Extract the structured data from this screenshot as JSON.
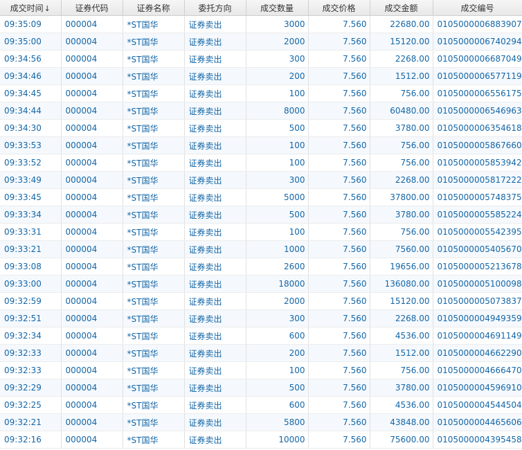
{
  "columns": [
    {
      "label": "成交时间",
      "sort_icon": "arrow-down-icon",
      "sort_glyph": "↓"
    },
    {
      "label": "证券代码"
    },
    {
      "label": "证券名称"
    },
    {
      "label": "委托方向"
    },
    {
      "label": "成交数量"
    },
    {
      "label": "成交价格"
    },
    {
      "label": "成交金额"
    },
    {
      "label": "成交编号"
    }
  ],
  "rows": [
    [
      "09:35:09",
      "000004",
      "*ST国华",
      "证券卖出",
      "3000",
      "7.560",
      "22680.00",
      "0105000006883907"
    ],
    [
      "09:35:00",
      "000004",
      "*ST国华",
      "证券卖出",
      "2000",
      "7.560",
      "15120.00",
      "0105000006740294"
    ],
    [
      "09:34:56",
      "000004",
      "*ST国华",
      "证券卖出",
      "300",
      "7.560",
      "2268.00",
      "0105000006687049"
    ],
    [
      "09:34:46",
      "000004",
      "*ST国华",
      "证券卖出",
      "200",
      "7.560",
      "1512.00",
      "0105000006577119"
    ],
    [
      "09:34:45",
      "000004",
      "*ST国华",
      "证券卖出",
      "100",
      "7.560",
      "756.00",
      "0105000006556175"
    ],
    [
      "09:34:44",
      "000004",
      "*ST国华",
      "证券卖出",
      "8000",
      "7.560",
      "60480.00",
      "0105000006546963"
    ],
    [
      "09:34:30",
      "000004",
      "*ST国华",
      "证券卖出",
      "500",
      "7.560",
      "3780.00",
      "0105000006354618"
    ],
    [
      "09:33:53",
      "000004",
      "*ST国华",
      "证券卖出",
      "100",
      "7.560",
      "756.00",
      "0105000005867660"
    ],
    [
      "09:33:52",
      "000004",
      "*ST国华",
      "证券卖出",
      "100",
      "7.560",
      "756.00",
      "0105000005853942"
    ],
    [
      "09:33:49",
      "000004",
      "*ST国华",
      "证券卖出",
      "300",
      "7.560",
      "2268.00",
      "0105000005817222"
    ],
    [
      "09:33:45",
      "000004",
      "*ST国华",
      "证券卖出",
      "5000",
      "7.560",
      "37800.00",
      "0105000005748375"
    ],
    [
      "09:33:34",
      "000004",
      "*ST国华",
      "证券卖出",
      "500",
      "7.560",
      "3780.00",
      "0105000005585224"
    ],
    [
      "09:33:31",
      "000004",
      "*ST国华",
      "证券卖出",
      "100",
      "7.560",
      "756.00",
      "0105000005542395"
    ],
    [
      "09:33:21",
      "000004",
      "*ST国华",
      "证券卖出",
      "1000",
      "7.560",
      "7560.00",
      "0105000005405670"
    ],
    [
      "09:33:08",
      "000004",
      "*ST国华",
      "证券卖出",
      "2600",
      "7.560",
      "19656.00",
      "0105000005213678"
    ],
    [
      "09:33:00",
      "000004",
      "*ST国华",
      "证券卖出",
      "18000",
      "7.560",
      "136080.00",
      "0105000005100098"
    ],
    [
      "09:32:59",
      "000004",
      "*ST国华",
      "证券卖出",
      "2000",
      "7.560",
      "15120.00",
      "0105000005073837"
    ],
    [
      "09:32:51",
      "000004",
      "*ST国华",
      "证券卖出",
      "300",
      "7.560",
      "2268.00",
      "0105000004949359"
    ],
    [
      "09:32:34",
      "000004",
      "*ST国华",
      "证券卖出",
      "600",
      "7.560",
      "4536.00",
      "0105000004691149"
    ],
    [
      "09:32:33",
      "000004",
      "*ST国华",
      "证券卖出",
      "200",
      "7.560",
      "1512.00",
      "0105000004662290"
    ],
    [
      "09:32:33",
      "000004",
      "*ST国华",
      "证券卖出",
      "100",
      "7.560",
      "756.00",
      "0105000004666470"
    ],
    [
      "09:32:29",
      "000004",
      "*ST国华",
      "证券卖出",
      "500",
      "7.560",
      "3780.00",
      "0105000004596910"
    ],
    [
      "09:32:25",
      "000004",
      "*ST国华",
      "证券卖出",
      "600",
      "7.560",
      "4536.00",
      "0105000004544504"
    ],
    [
      "09:32:21",
      "000004",
      "*ST国华",
      "证券卖出",
      "5800",
      "7.560",
      "43848.00",
      "0105000004465606"
    ],
    [
      "09:32:16",
      "000004",
      "*ST国华",
      "证券卖出",
      "10000",
      "7.560",
      "75600.00",
      "0105000004395458"
    ]
  ],
  "colors": {
    "text": "#1466a6",
    "header_text": "#333333",
    "row_alt": "#f5f9fd"
  }
}
